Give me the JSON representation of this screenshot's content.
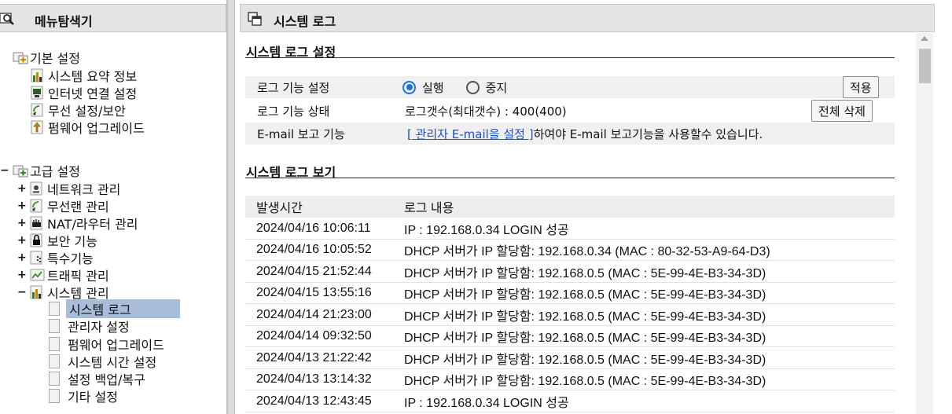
{
  "left_panel": {
    "title": "메뉴탐색기",
    "groups": [
      {
        "label": "기본 설정",
        "expanded": true,
        "items": [
          {
            "label": "시스템 요약 정보",
            "icon": "bar-chart-icon"
          },
          {
            "label": "인터넷 연결 설정",
            "icon": "globe-icon"
          },
          {
            "label": "무선 설정/보안",
            "icon": "wifi-icon"
          },
          {
            "label": "펌웨어 업그레이드",
            "icon": "upgrade-icon"
          }
        ]
      },
      {
        "label": "고급 설정",
        "expanded": true,
        "expander": "−",
        "items": [
          {
            "label": "네트워크 관리",
            "icon": "network-icon",
            "expander": "+"
          },
          {
            "label": "무선랜 관리",
            "icon": "wifi-icon",
            "expander": "+"
          },
          {
            "label": "NAT/라우터 관리",
            "icon": "router-icon",
            "expander": "+"
          },
          {
            "label": "보안 기능",
            "icon": "lock-icon",
            "expander": "+"
          },
          {
            "label": "특수기능",
            "icon": "special-icon",
            "expander": "+"
          },
          {
            "label": "트래픽 관리",
            "icon": "traffic-icon",
            "expander": "+"
          },
          {
            "label": "시스템 관리",
            "icon": "bar-chart-icon",
            "expander": "−"
          }
        ],
        "system_items": [
          {
            "label": "시스템 로그",
            "selected": true
          },
          {
            "label": "관리자 설정"
          },
          {
            "label": "펌웨어 업그레이드"
          },
          {
            "label": "시스템 시간 설정"
          },
          {
            "label": "설정 백업/복구"
          },
          {
            "label": "기타 설정"
          }
        ]
      }
    ]
  },
  "right_panel": {
    "title": "시스템 로그",
    "settings_section": {
      "title": "시스템 로그 설정",
      "rows": [
        {
          "key": "로그 기능 설정",
          "radio_on": "실행",
          "radio_off": "중지",
          "button": "적용"
        },
        {
          "key": "로그 기능 상태",
          "value": "로그갯수(최대갯수) : 400(400)",
          "button": "전체 삭제"
        },
        {
          "key": "E-mail 보고 기능",
          "link": "[ 관리자 E-mail을 설정 ]",
          "value": "하여야 E-mail 보고기능을 사용할수 있습니다."
        }
      ]
    },
    "log_section": {
      "title": "시스템 로그 보기",
      "columns": [
        "발생시간",
        "로그 내용"
      ],
      "rows": [
        {
          "time": "2024/04/16 10:06:11",
          "msg": "IP : 192.168.0.34 LOGIN 성공"
        },
        {
          "time": "2024/04/16 10:05:52",
          "msg": "DHCP 서버가 IP 할당함: 192.168.0.34 (MAC : 80-32-53-A9-64-D3)"
        },
        {
          "time": "2024/04/15 21:52:44",
          "msg": "DHCP 서버가 IP 할당함: 192.168.0.5 (MAC : 5E-99-4E-B3-34-3D)"
        },
        {
          "time": "2024/04/15 13:55:16",
          "msg": "DHCP 서버가 IP 할당함: 192.168.0.5 (MAC : 5E-99-4E-B3-34-3D)"
        },
        {
          "time": "2024/04/14 21:23:00",
          "msg": "DHCP 서버가 IP 할당함: 192.168.0.5 (MAC : 5E-99-4E-B3-34-3D)"
        },
        {
          "time": "2024/04/14 09:32:50",
          "msg": "DHCP 서버가 IP 할당함: 192.168.0.5 (MAC : 5E-99-4E-B3-34-3D)"
        },
        {
          "time": "2024/04/13 21:22:42",
          "msg": "DHCP 서버가 IP 할당함: 192.168.0.5 (MAC : 5E-99-4E-B3-34-3D)"
        },
        {
          "time": "2024/04/13 13:14:32",
          "msg": "DHCP 서버가 IP 할당함: 192.168.0.5 (MAC : 5E-99-4E-B3-34-3D)"
        },
        {
          "time": "2024/04/13 12:43:45",
          "msg": "IP : 192.168.0.34 LOGIN 성공"
        }
      ]
    }
  },
  "colors": {
    "header_bg": "#e4e4e4",
    "selected_bg": "#a9bcd9",
    "link": "#1a4fd0",
    "radio": "#1b73d9"
  }
}
